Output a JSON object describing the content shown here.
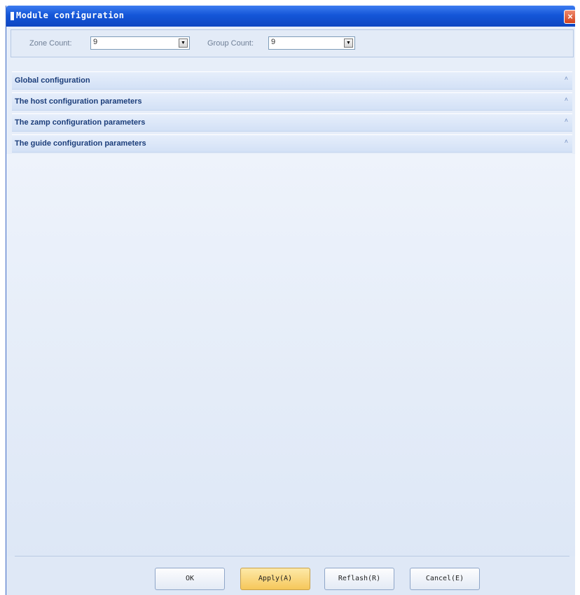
{
  "window": {
    "title": "Module configuration",
    "close_label": "×"
  },
  "toolbar": {
    "zone_count_label": "Zone Count:",
    "zone_count_value": "9",
    "group_count_label": "Group Count:",
    "group_count_value": "9",
    "dropdown_arrow": "▼"
  },
  "sections": [
    {
      "title": "Global configuration",
      "chevron": "˄"
    },
    {
      "title": "The host configuration parameters",
      "chevron": "˄"
    },
    {
      "title": "The zamp configuration parameters",
      "chevron": "˄"
    },
    {
      "title": "The guide configuration parameters",
      "chevron": "˄"
    }
  ],
  "buttons": {
    "ok": "OK",
    "apply": "Apply(A)",
    "refresh": "Reflash(R)",
    "cancel": "Cancel(E)"
  },
  "colors": {
    "titlebar": "#1456d8",
    "panel": "#e7eef9",
    "section_header": "#d3e1f6",
    "active_button": "#f6c75a"
  }
}
